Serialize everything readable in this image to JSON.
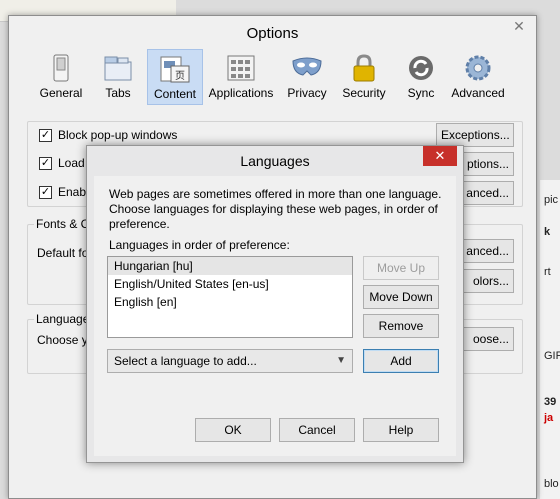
{
  "background": {
    "right_fragments": [
      "pic",
      "k",
      "rt",
      "GIF",
      "39",
      "ja",
      "blo"
    ]
  },
  "options": {
    "title": "Options",
    "close_glyph": "✕",
    "toolbar": [
      {
        "label": "General",
        "icon": "switch-icon"
      },
      {
        "label": "Tabs",
        "icon": "tabs-icon"
      },
      {
        "label": "Content",
        "icon": "content-icon"
      },
      {
        "label": "Applications",
        "icon": "applications-icon"
      },
      {
        "label": "Privacy",
        "icon": "mask-icon"
      },
      {
        "label": "Security",
        "icon": "lock-icon"
      },
      {
        "label": "Sync",
        "icon": "sync-icon"
      },
      {
        "label": "Advanced",
        "icon": "gear-icon"
      }
    ],
    "selected_tab": "Content",
    "content": {
      "block_popups": "Block pop-up windows",
      "load_images": "Load",
      "enable_js": "Enabl",
      "exceptions_button": "Exceptions...",
      "exceptions_button_2": "ptions...",
      "advanced_button": "anced...",
      "fonts_group_label": "Fonts & C",
      "default_font_label": "Default fo",
      "fonts_advanced_button": "anced...",
      "colors_button": "olors...",
      "languages_group_label": "Language",
      "choose_label": "Choose yo",
      "choose_button": "oose..."
    }
  },
  "dialog": {
    "title": "Languages",
    "close_glyph": "✕",
    "description": "Web pages are sometimes offered in more than one language. Choose languages for displaying these web pages, in order of preference.",
    "list_label": "Languages in order of preference:",
    "languages": [
      "Hungarian  [hu]",
      "English/United States  [en-us]",
      "English  [en]"
    ],
    "move_up": "Move Up",
    "move_down": "Move Down",
    "remove": "Remove",
    "select_placeholder": "Select a language to add...",
    "add": "Add",
    "ok": "OK",
    "cancel": "Cancel",
    "help": "Help",
    "colors": {
      "close_bg": "#c7302a",
      "selected_tab_bg": "#c9dcf4"
    }
  }
}
